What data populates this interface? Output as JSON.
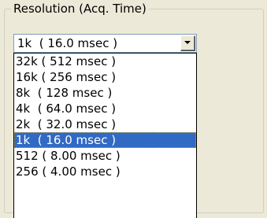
{
  "groupbox": {
    "title": "Resolution (Acq. Time)"
  },
  "combo": {
    "selected_value": "1k  ( 16.0 msec )",
    "dropdown_icon": "chevron-down-icon"
  },
  "dropdown": {
    "options": [
      {
        "label": "32k ( 512 msec )"
      },
      {
        "label": "16k ( 256 msec )"
      },
      {
        "label": "8k  ( 128 msec )"
      },
      {
        "label": "4k  ( 64.0 msec )"
      },
      {
        "label": "2k  ( 32.0 msec )"
      },
      {
        "label": "1k  ( 16.0 msec )"
      },
      {
        "label": "512 ( 8.00 msec )"
      },
      {
        "label": "256 ( 4.00 msec )"
      }
    ],
    "selected_label": "1k  ( 16.0 msec )",
    "selected_color": "#316ac5"
  }
}
